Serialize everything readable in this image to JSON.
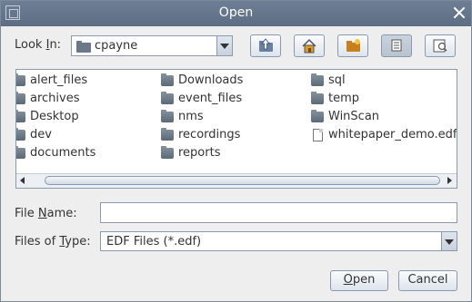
{
  "window": {
    "title": "Open"
  },
  "look_in": {
    "label_prefix": "Look ",
    "label_mnemonic": "I",
    "label_suffix": "n:",
    "value": "cpayne"
  },
  "toolbar": {
    "buttons": [
      {
        "name": "up-one-level",
        "icon": "folder-up-icon"
      },
      {
        "name": "home",
        "icon": "home-icon"
      },
      {
        "name": "new-folder",
        "icon": "new-folder-icon"
      },
      {
        "name": "list-view",
        "icon": "list-icon",
        "selected": true
      },
      {
        "name": "details-view",
        "icon": "details-icon"
      }
    ]
  },
  "files": {
    "columns": [
      [
        {
          "name": "alert_files",
          "type": "folder"
        },
        {
          "name": "archives",
          "type": "folder"
        },
        {
          "name": "Desktop",
          "type": "folder"
        },
        {
          "name": "dev",
          "type": "folder"
        },
        {
          "name": "documents",
          "type": "folder"
        }
      ],
      [
        {
          "name": "Downloads",
          "type": "folder"
        },
        {
          "name": "event_files",
          "type": "folder"
        },
        {
          "name": "nms",
          "type": "folder"
        },
        {
          "name": "recordings",
          "type": "folder"
        },
        {
          "name": "reports",
          "type": "folder"
        }
      ],
      [
        {
          "name": "sql",
          "type": "folder"
        },
        {
          "name": "temp",
          "type": "folder"
        },
        {
          "name": "WinScan",
          "type": "folder"
        },
        {
          "name": "whitepaper_demo.edf",
          "type": "file"
        }
      ]
    ]
  },
  "file_name": {
    "label_prefix": "File ",
    "label_mnemonic": "N",
    "label_suffix": "ame:",
    "value": ""
  },
  "file_type": {
    "label_prefix": "Files of ",
    "label_mnemonic": "T",
    "label_suffix": "ype:",
    "value": "EDF Files (*.edf)"
  },
  "buttons": {
    "open_mnemonic": "O",
    "open_rest": "pen",
    "cancel": "Cancel"
  },
  "colors": {
    "titlebar": "#5d6d84",
    "background": "#eeeeee",
    "border": "#8a99ad",
    "folder_icon": "#6b7885"
  }
}
